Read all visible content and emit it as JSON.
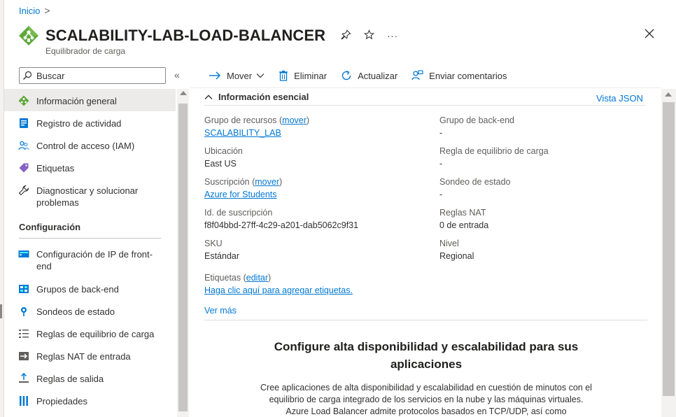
{
  "breadcrumb": {
    "home": "Inicio",
    "sep": ">"
  },
  "header": {
    "title": "SCALABILITY-LAB-LOAD-BALANCER",
    "subtitle": "Equilibrador de carga",
    "pin_icon": "pin-icon",
    "favorite_icon": "star-icon",
    "more": "···",
    "close": "✕"
  },
  "sidebar": {
    "search_placeholder": "Buscar",
    "collapse": "«",
    "items": [
      {
        "label": "Información general",
        "icon": "overview-icon"
      },
      {
        "label": "Registro de actividad",
        "icon": "activity-log-icon"
      },
      {
        "label": "Control de acceso (IAM)",
        "icon": "iam-icon"
      },
      {
        "label": "Etiquetas",
        "icon": "tag-icon"
      },
      {
        "label": "Diagnosticar y solucionar problemas",
        "icon": "wrench-icon"
      }
    ],
    "section": "Configuración",
    "config_items": [
      {
        "label": "Configuración de IP de front-end",
        "icon": "frontend-ip-icon"
      },
      {
        "label": "Grupos de back-end",
        "icon": "backend-pool-icon"
      },
      {
        "label": "Sondeos de estado",
        "icon": "health-probe-icon"
      },
      {
        "label": "Reglas de equilibrio de carga",
        "icon": "lb-rules-icon"
      },
      {
        "label": "Reglas NAT de entrada",
        "icon": "nat-rules-icon"
      },
      {
        "label": "Reglas de salida",
        "icon": "outbound-rules-icon"
      },
      {
        "label": "Propiedades",
        "icon": "properties-icon"
      }
    ]
  },
  "toolbar": {
    "move": "Mover",
    "delete": "Eliminar",
    "refresh": "Actualizar",
    "feedback": "Enviar comentarios"
  },
  "essentials": {
    "header": "Información esencial",
    "json_view": "Vista JSON",
    "resource_group_label": "Grupo de recursos",
    "move_link": "mover",
    "resource_group_value": "SCALABILITY_LAB",
    "location_label": "Ubicación",
    "location_value": "East US",
    "subscription_label": "Suscripción",
    "subscription_value": "Azure for Students",
    "subscription_id_label": "Id. de suscripción",
    "subscription_id_value": "f8f04bbd-27ff-4c29-a201-dab5062c9f31",
    "sku_label": "SKU",
    "sku_value": "Estándar",
    "backend_pool_label": "Grupo de back-end",
    "backend_pool_value": "-",
    "lb_rule_label": "Regla de equilibrio de carga",
    "lb_rule_value": "-",
    "probe_label": "Sondeo de estado",
    "probe_value": "-",
    "nat_label": "Reglas NAT",
    "nat_value": "0 de entrada",
    "tier_label": "Nivel",
    "tier_value": "Regional",
    "tags_label": "Etiquetas",
    "edit_link": "editar",
    "tags_add_link": "Haga clic aquí para agregar etiquetas.",
    "see_more": "Ver más"
  },
  "promo": {
    "title": "Configure alta disponibilidad y escalabilidad para sus aplicaciones",
    "body": "Cree aplicaciones de alta disponibilidad y escalabilidad en cuestión de minutos con el equilibrio de carga integrado de los servicios en la nube y las máquinas virtuales. Azure Load Balancer admite protocolos basados en TCP/UDP, así como"
  },
  "colors": {
    "accent": "#0078d4",
    "resource_icon": "#5ea93a"
  }
}
